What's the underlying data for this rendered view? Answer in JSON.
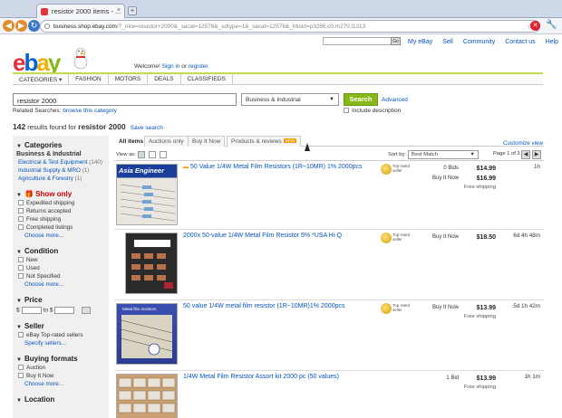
{
  "browser": {
    "tab_title": "resistor 2000 items - ...",
    "tab_close": "×",
    "new_tab": "+",
    "back": "◀",
    "forward": "▶",
    "reload": "↻",
    "url_host": "business.shop.ebay.com",
    "url_path": "/?_nkw=resistor+2000&_sacat=12576&_sdtype=1&_sacat=12576&_trksid=p3286.c0.m270.l1313",
    "bookmark_star": "☆",
    "stop": "✕",
    "wrench": "🔧"
  },
  "header": {
    "logo": {
      "e": "e",
      "b": "b",
      "a": "a",
      "y": "y"
    },
    "welcome_prefix": "Welcome!",
    "sign_in": "Sign in",
    "or": "or",
    "register": "register.",
    "go_label": "Go",
    "top_links": [
      "My eBay",
      "Sell",
      "Community",
      "Contact us",
      "Help"
    ],
    "categories": [
      "CATEGORIES ▾",
      "FASHION",
      "MOTORS",
      "DEALS",
      "CLASSIFIEDS"
    ]
  },
  "search": {
    "query": "resistor 2000",
    "category": "Business & Industrial",
    "button": "Search",
    "advanced": "Advanced",
    "include_description": "Include description",
    "related_label": "Related Searches:",
    "related_link": "browse this category",
    "results_count": "142",
    "results_text": "results found for",
    "results_query": "resistor 2000",
    "save_search": "Save search"
  },
  "sidebar": {
    "categories_title": "Categories",
    "parent_category": "Business & Industrial",
    "categories": [
      {
        "name": "Electrical & Test Equipment",
        "count": "(140)"
      },
      {
        "name": "Industrial Supply & MRO",
        "count": "(1)"
      },
      {
        "name": "Agriculture & Forestry",
        "count": "(1)"
      }
    ],
    "show_only_title": "Show only",
    "show_only": [
      "Expedited shipping",
      "Returns accepted",
      "Free shipping",
      "Completed listings"
    ],
    "more": "Choose more...",
    "condition_title": "Condition",
    "condition": [
      "New",
      "Used",
      "Not Specified"
    ],
    "price_title": "Price",
    "price_from": "$",
    "price_to": "to $",
    "seller_title": "Seller",
    "seller": [
      "eBay Top-rated sellers"
    ],
    "seller_more": "Specify sellers...",
    "buying_title": "Buying formats",
    "buying": [
      "Auction",
      "Buy It Now"
    ],
    "location_title": "Location"
  },
  "results": {
    "tabs": [
      "All items",
      "Auctions only",
      "Buy It Now",
      "Products & reviews"
    ],
    "new_badge": "NEW",
    "customize": "Customize view",
    "view_as": "View as:",
    "sort_by": "Sort by:",
    "sort_value": "Best Match",
    "page_of": "Page 1 of 3",
    "prev": "◀",
    "next": "▶",
    "items": [
      {
        "title": "50 Value 1/4W Metal Film Resistors (1R~10MR) 1% 2000pcs",
        "top_rated": true,
        "top_rated_label": "Top-rated seller",
        "bids": "0 Bids",
        "bin": "Buy It Now",
        "price": "$14.99",
        "bin_price": "$16.99",
        "shipping": "Free shipping",
        "time": "1h",
        "thumb_caption": "Asia Engineer"
      },
      {
        "title": "2000x 50-value 1/4W Metal Film Resistor 5% *USA Hi-Q",
        "top_rated": true,
        "top_rated_label": "Top-rated seller",
        "bids": "Buy It Now",
        "bin": "",
        "price": "$18.50",
        "bin_price": "",
        "shipping": "",
        "time": "6d 4h 48m",
        "thumb_caption": ""
      },
      {
        "title": "50 value 1/4W metal film resistor (1R~10MR)1% 2000pcs",
        "top_rated": true,
        "top_rated_label": "Top-rated seller",
        "bids": "Buy It Now",
        "bin": "",
        "price": "$13.99",
        "bin_price": "",
        "shipping": "Free shipping",
        "time": "5d 1h 42m",
        "thumb_caption": "Metal film resistors"
      },
      {
        "title": "1/4W Metal Film Resistor Assort kit 2000 pc (50 values)",
        "top_rated": false,
        "top_rated_label": "",
        "bids": "1 Bid",
        "bin": "",
        "price": "$13.99",
        "bin_price": "",
        "shipping": "Free shipping",
        "time": "1h 1m",
        "thumb_caption": ""
      }
    ]
  }
}
